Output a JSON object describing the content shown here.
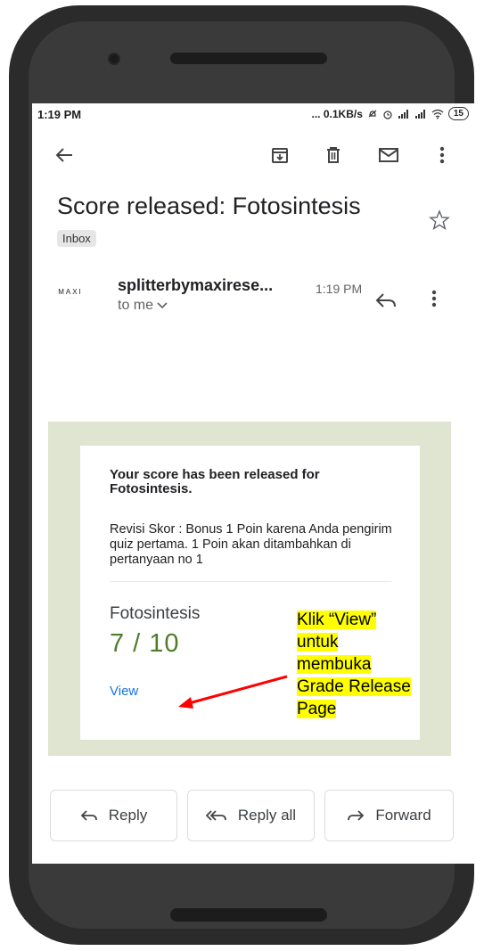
{
  "status_bar": {
    "time": "1:19 PM",
    "network": "... 0.1KB/s",
    "battery": "15"
  },
  "email": {
    "subject": "Score released: Fotosintesis",
    "label_chip": "Inbox",
    "sender": "splitterbymaxirese...",
    "sender_logo_text": "MAXI",
    "time": "1:19 PM",
    "recipient": "to me"
  },
  "card": {
    "title": "Your score has been released for Fotosintesis.",
    "body": "Revisi Skor : Bonus 1 Poin karena Anda pengirim quiz pertama. 1 Poin akan ditambahkan di pertanyaan no 1",
    "quiz_name": "Fotosintesis",
    "score": "7 / 10",
    "view_link": "View"
  },
  "annotation": {
    "lines": [
      "Klik “View”",
      "untuk",
      "membuka",
      "Grade Release",
      "Page"
    ],
    "color": "#ffff00",
    "arrow_color": "#ff0000"
  },
  "actions": {
    "reply": "Reply",
    "reply_all": "Reply all",
    "forward": "Forward"
  }
}
